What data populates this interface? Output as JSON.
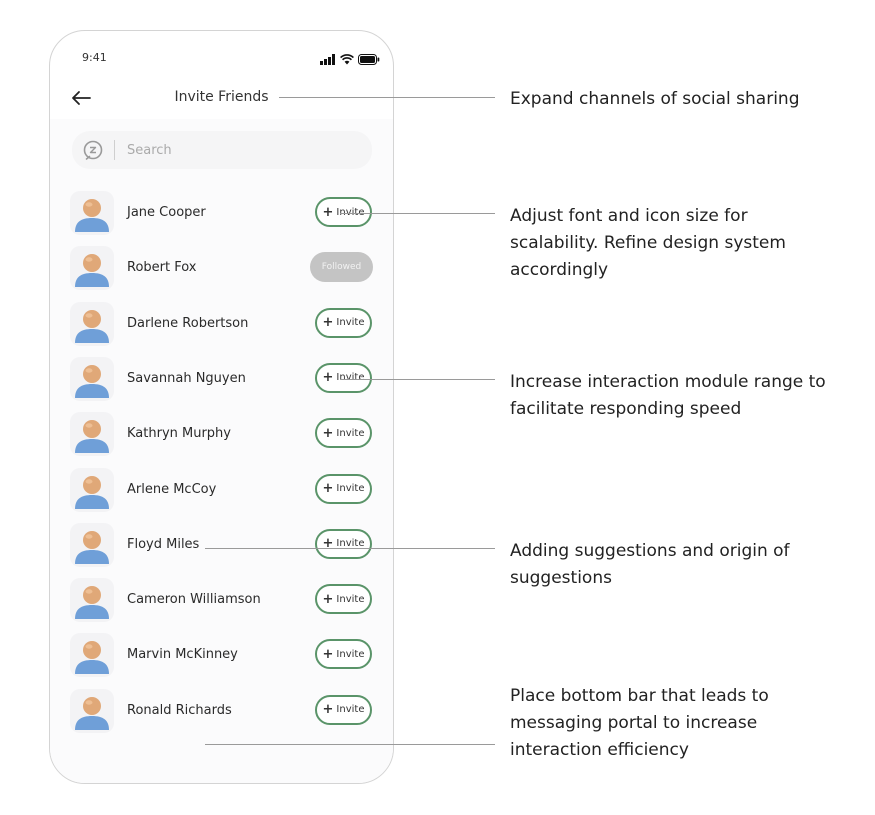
{
  "status_bar": {
    "time": "9:41"
  },
  "header": {
    "title": "Invite Friends"
  },
  "search": {
    "placeholder": "Search"
  },
  "contacts": [
    {
      "name": "Jane Cooper",
      "action": "Invite"
    },
    {
      "name": "Robert Fox",
      "action": "Followed"
    },
    {
      "name": "Darlene Robertson",
      "action": "Invite"
    },
    {
      "name": "Savannah Nguyen",
      "action": "Invite"
    },
    {
      "name": "Kathryn Murphy",
      "action": "Invite"
    },
    {
      "name": "Arlene McCoy",
      "action": "Invite"
    },
    {
      "name": "Floyd Miles",
      "action": "Invite"
    },
    {
      "name": "Cameron Williamson",
      "action": "Invite"
    },
    {
      "name": "Marvin McKinney",
      "action": "Invite"
    },
    {
      "name": "Ronald Richards",
      "action": "Invite"
    }
  ],
  "annotations": [
    "Expand channels of social sharing",
    "Adjust font and icon size for scalability. Refine design system accordingly",
    "Increase interaction module range to facilitate responding speed",
    "Adding suggestions and origin of suggestions",
    "Place bottom bar that leads to messaging portal to increase interaction efficiency"
  ],
  "colors": {
    "invite_border": "#5a9469",
    "followed_bg": "#c4c4c4",
    "avatar_shirt": "#6f9fd8",
    "avatar_skin": "#e0a878"
  }
}
